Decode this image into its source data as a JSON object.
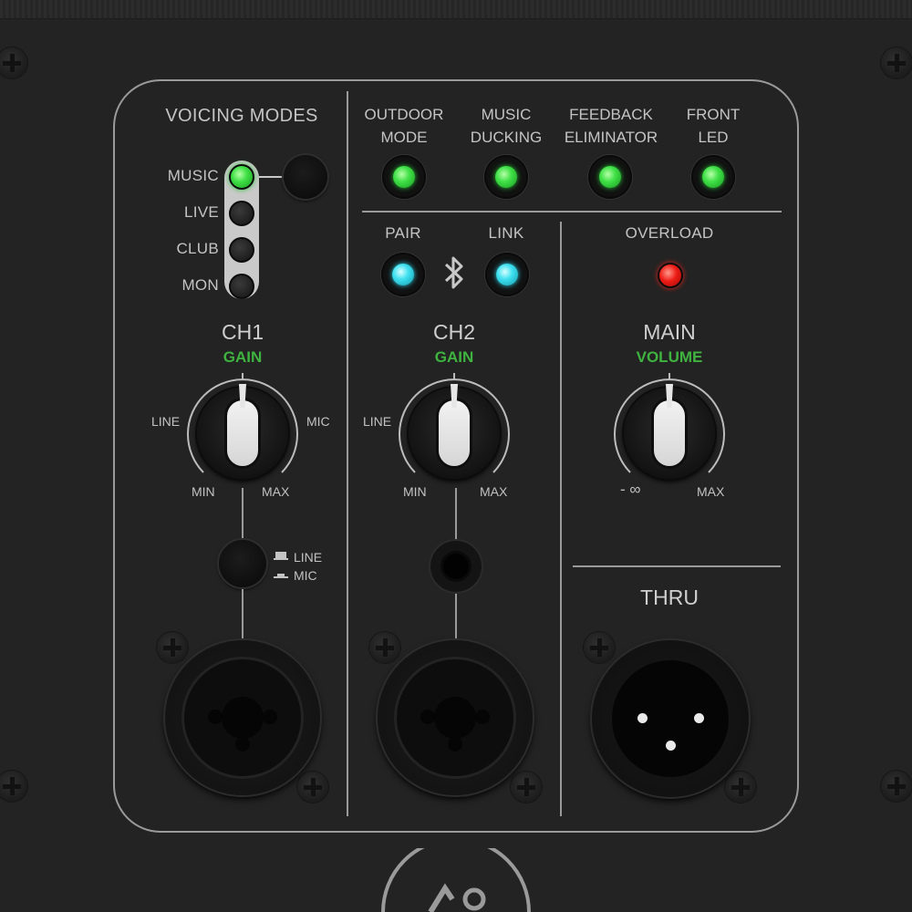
{
  "voicing": {
    "title": "VOICING MODES",
    "modes": [
      "MUSIC",
      "LIVE",
      "CLUB",
      "MON"
    ],
    "active_mode": "MUSIC"
  },
  "features": {
    "outdoor_mode": [
      "OUTDOOR",
      "MODE"
    ],
    "music_ducking": [
      "MUSIC",
      "DUCKING"
    ],
    "feedback_eliminator": [
      "FEEDBACK",
      "ELIMINATOR"
    ],
    "front_led": [
      "FRONT",
      "LED"
    ]
  },
  "bluetooth": {
    "pair": "PAIR",
    "link": "LINK"
  },
  "overload": "OVERLOAD",
  "ch1": {
    "title": "CH1",
    "knob_label": "GAIN",
    "left": "LINE",
    "right": "MIC",
    "min": "MIN",
    "max": "MAX",
    "switch_line": "LINE",
    "switch_mic": "MIC"
  },
  "ch2": {
    "title": "CH2",
    "knob_label": "GAIN",
    "left": "LINE",
    "min": "MIN",
    "max": "MAX"
  },
  "main": {
    "title": "MAIN",
    "knob_label": "VOLUME",
    "min": "- ∞",
    "max": "MAX"
  },
  "thru": {
    "title": "THRU"
  },
  "colors": {
    "led_green": "#3fe046",
    "led_cyan": "#3ee0f0",
    "led_red": "#ee1c16",
    "label_green": "#3fb33f"
  }
}
